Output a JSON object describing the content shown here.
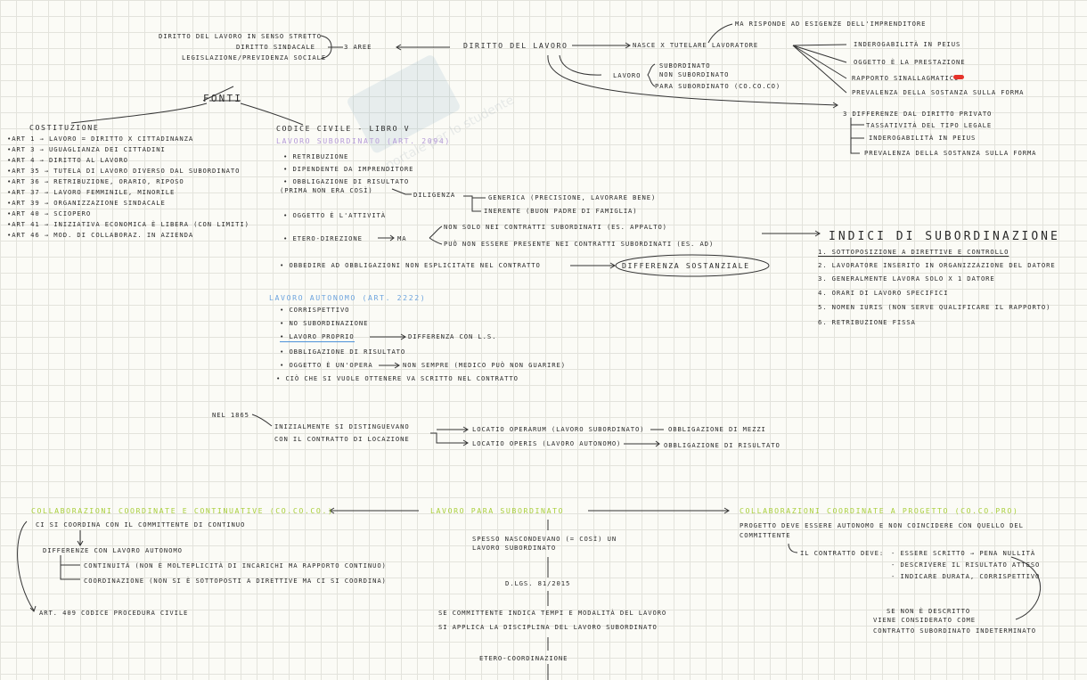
{
  "diritto": {
    "left1": "DIRITTO DEL LAVORO IN SENSO STRETTO",
    "left2": "DIRITTO SINDACALE",
    "left3": "LEGISLAZIONE/PREVIDENZA SOCIALE",
    "aree": "3 AREE",
    "title": "DIRITTO DEL LAVORO",
    "nasce": "NASCE X TUTELARE LAVORATORE",
    "esigenze": "MA RISPONDE AD ESIGENZE DELL'IMPRENDITORE",
    "lavoro": "LAVORO",
    "sub1": "SUBORDINATO",
    "sub2": "NON SUBORDINATO",
    "sub3": "PARA SUBORDINATO (CO.CO.CO)",
    "r1": "INDEROGABILITÀ IN PEIUS",
    "r2": "OGGETTO È LA PRESTAZIONE",
    "r3": "RAPPORTO SINALLAGMATICO",
    "r4": "PREVALENZA DELLA SOSTANZA SULLA FORMA",
    "diff": "3 DIFFERENZE DAL DIRITTO PRIVATO",
    "d1": "TASSATIVITÀ DEL TIPO LEGALE",
    "d2": "INDEROGABILITÀ IN PEIUS",
    "d3": "PREVALENZA DELLA SOSTANZA SULLA FORMA"
  },
  "fonti": {
    "title": "FONTI",
    "costituzione": "COSTITUZIONE",
    "arts": [
      "•ART 1 → LAVORO = DIRITTO X CITTADINANZA",
      "•ART 3 → UGUAGLIANZA DEI CITTADINI",
      "•ART 4 → DIRITTO AL LAVORO",
      "•ART 35 → TUTELA DI LAVORO DIVERSO DAL SUBORDINATO",
      "•ART 36 → RETRIBUZIONE, ORARIO, RIPOSO",
      "•ART 37 → LAVORO FEMMINILE, MINORILE",
      "•ART 39 → ORGANIZZAZIONE SINDACALE",
      "•ART 40 → SCIOPERO",
      "•ART 41 → INIZIATIVA ECONOMICA È LIBERA (CON LIMITI)",
      "•ART 46 → MOD. DI COLLABORAZ. IN AZIENDA"
    ],
    "codice": "CODICE CIVILE - LIBRO V"
  },
  "subordinato": {
    "title": "LAVORO SUBORDINATO (ART. 2094)",
    "items": [
      "• RETRIBUZIONE",
      "• DIPENDENTE DA IMPRENDITORE",
      "• OBBLIGAZIONE DI RISULTATO",
      "(PRIMA NON ERA COSÌ)",
      "• OGGETTO È L'ATTIVITÀ",
      "• ETERO-DIREZIONE",
      "• OBBEDIRE AD OBBLIGAZIONI NON ESPLICITATE NEL CONTRATTO"
    ],
    "diligenza": "DILIGENZA",
    "generica": "GENERICA (PRECISIONE, LAVORARE BENE)",
    "inerente": "INERENTE (BUON PADRE DI FAMIGLIA)",
    "ma": "MA",
    "nonsolo": "NON SOLO NEI CONTRATTI SUBORDINATI (ES. APPALTO)",
    "puo": "PUÒ NON ESSERE PRESENTE NEI CONTRATTI SUBORDINATI (ES. AD)",
    "differenza": "DIFFERENZA SOSTANZIALE"
  },
  "indici": {
    "title": "INDICI DI SUBORDINAZIONE",
    "items": [
      "1. SOTTOPOSIZIONE A DIRETTIVE E CONTROLLO",
      "2. LAVORATORE INSERITO IN ORGANIZZAZIONE DEL DATORE",
      "3. GENERALMENTE LAVORA SOLO X 1 DATORE",
      "4. ORARI DI LAVORO SPECIFICI",
      "5. NOMEN IURIS (NON SERVE QUALIFICARE IL RAPPORTO)",
      "6. RETRIBUZIONE FISSA"
    ]
  },
  "autonomo": {
    "title": "LAVORO AUTONOMO (ART. 2222)",
    "items": [
      "• CORRISPETTIVO",
      "• NO SUBORDINAZIONE",
      "• LAVORO PROPRIO",
      "• OBBLIGAZIONE DI RISULTATO",
      "• OGGETTO È UN'OPERA",
      "• CIÒ CHE SI VUOLE OTTENERE VA SCRITTO NEL CONTRATTO"
    ],
    "diffls": "DIFFERENZA CON L.S.",
    "nonsempre": "NON SEMPRE (MEDICO PUÒ NON GUARIRE)"
  },
  "storia": {
    "nel": "NEL 1865",
    "ini1": "INIZIALMENTE SI DISTINGUEVANO",
    "ini2": "CON IL CONTRATTO DI LOCAZIONE",
    "loc1": "LOCATIO OPERARUM (LAVORO SUBORDINATO)",
    "obb1": "OBBLIGAZIONE DI MEZZI",
    "loc2": "LOCATIO OPERIS (LAVORO AUTONOMO)",
    "obb2": "OBBLIGAZIONE DI RISULTATO"
  },
  "para": {
    "left_title": "COLLABORAZIONI COORDINATE E CONTINUATIVE (CO.CO.CO.)",
    "l1": "CI SI COORDINA CON IL COMMITTENTE DI CONTINUO",
    "l2": "DIFFERENZE CON LAVORO AUTONOMO",
    "l3": "CONTINUITÀ (NON È MOLTEPLICITÀ DI INCARICHI MA RAPPORTO CONTINUO)",
    "l4": "COORDINAZIONE (NON SI È SOTTOPOSTI A DIRETTIVE MA CI SI COORDINA)",
    "l5": "ART. 409 CODICE PROCEDURA CIVILE",
    "center_title": "LAVORO PARA SUBORDINATO",
    "c1": "SPESSO NASCONDEVANO (= COSÌ) UN",
    "c2": "LAVORO SUBORDINATO",
    "c3": "D.LGS. 81/2015",
    "c4": "SE COMMITTENTE INDICA TEMPI E MODALITÀ DEL LAVORO",
    "c5": "SI APPLICA LA DISCIPLINA DEL LAVORO SUBORDINATO",
    "c6": "ETERO-COORDINAZIONE",
    "right_title": "COLLABORAZIONI COORDINATE A PROGETTO (CO.CO.PRO)",
    "r1": "PROGETTO DEVE ESSERE AUTONOMO E NON COINCIDERE CON QUELLO DEL",
    "r2": "COMMITTENTE",
    "r3": "IL CONTRATTO DEVE:",
    "r4": "- ESSERE SCRITTO → PENA NULLITÀ",
    "r5": "- DESCRIVERE IL RISULTATO ATTESO",
    "r6": "- INDICARE DURATA, CORRISPETTIVO",
    "r7": "SE NON È DESCRITTO",
    "r8": "VIENE CONSIDERATO COME",
    "r9": "CONTRATTO SUBORDINATO INDETERMINATO"
  },
  "watermark": "portale per lo studente"
}
